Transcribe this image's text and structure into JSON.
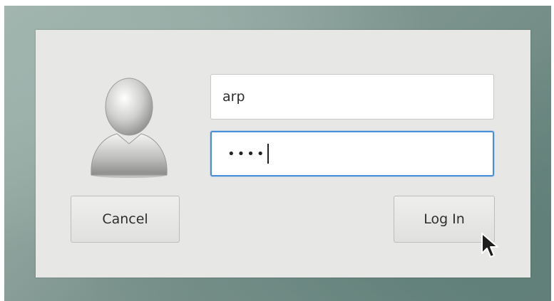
{
  "login_dialog": {
    "username": {
      "value": "arp"
    },
    "password": {
      "masked_value": "••••"
    },
    "cancel_button": {
      "label": "Cancel"
    },
    "login_button": {
      "label": "Log In"
    }
  },
  "icons": {
    "avatar": "user-avatar-icon",
    "cursor": "mouse-pointer-icon"
  },
  "colors": {
    "dialog_background": "#e7e7e5",
    "focus_border": "#4a90d9",
    "desktop_background": "#7f9690"
  }
}
